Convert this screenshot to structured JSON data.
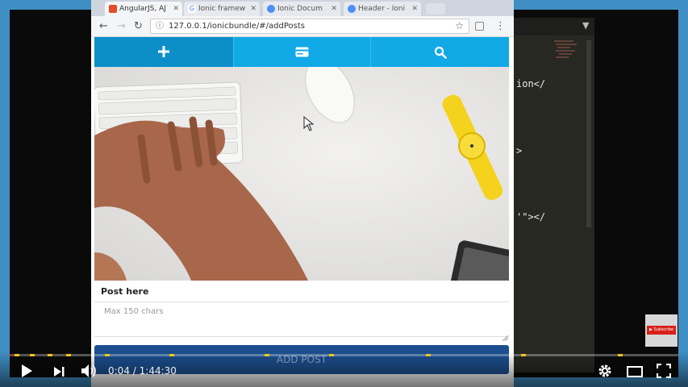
{
  "browser": {
    "tabs": [
      {
        "label": "AngularJS, AJ",
        "active": true,
        "favicon_color": "#e44d26"
      },
      {
        "label": "Ionic framew",
        "active": false,
        "favicon_color": "#4285f4"
      },
      {
        "label": "Ionic Docum",
        "active": false,
        "favicon_color": "#4e8ef7"
      },
      {
        "label": "Header - Ioni",
        "active": false,
        "favicon_color": "#4e8ef7"
      }
    ],
    "url": "127.0.0.1/ionicbundle/#/addPosts"
  },
  "app": {
    "nav_icons": [
      "plus-icon",
      "card-icon",
      "search-icon"
    ],
    "post_label": "Post here",
    "post_placeholder": "Max 150 chars",
    "add_button": "ADD POST",
    "colors": {
      "nav": "#11a9e6",
      "nav_active": "#0c8fc9",
      "button": "#1c4f8f"
    }
  },
  "editor": {
    "lines": [
      "ion</",
      ">",
      "'\"></"
    ]
  },
  "subscribe": {
    "label": "Subscribe"
  },
  "player": {
    "time_current": "0:04",
    "time_separator": "/",
    "time_total": "1:44:30",
    "progress": 0.0006,
    "ad_marker_color": "#f5c518"
  }
}
